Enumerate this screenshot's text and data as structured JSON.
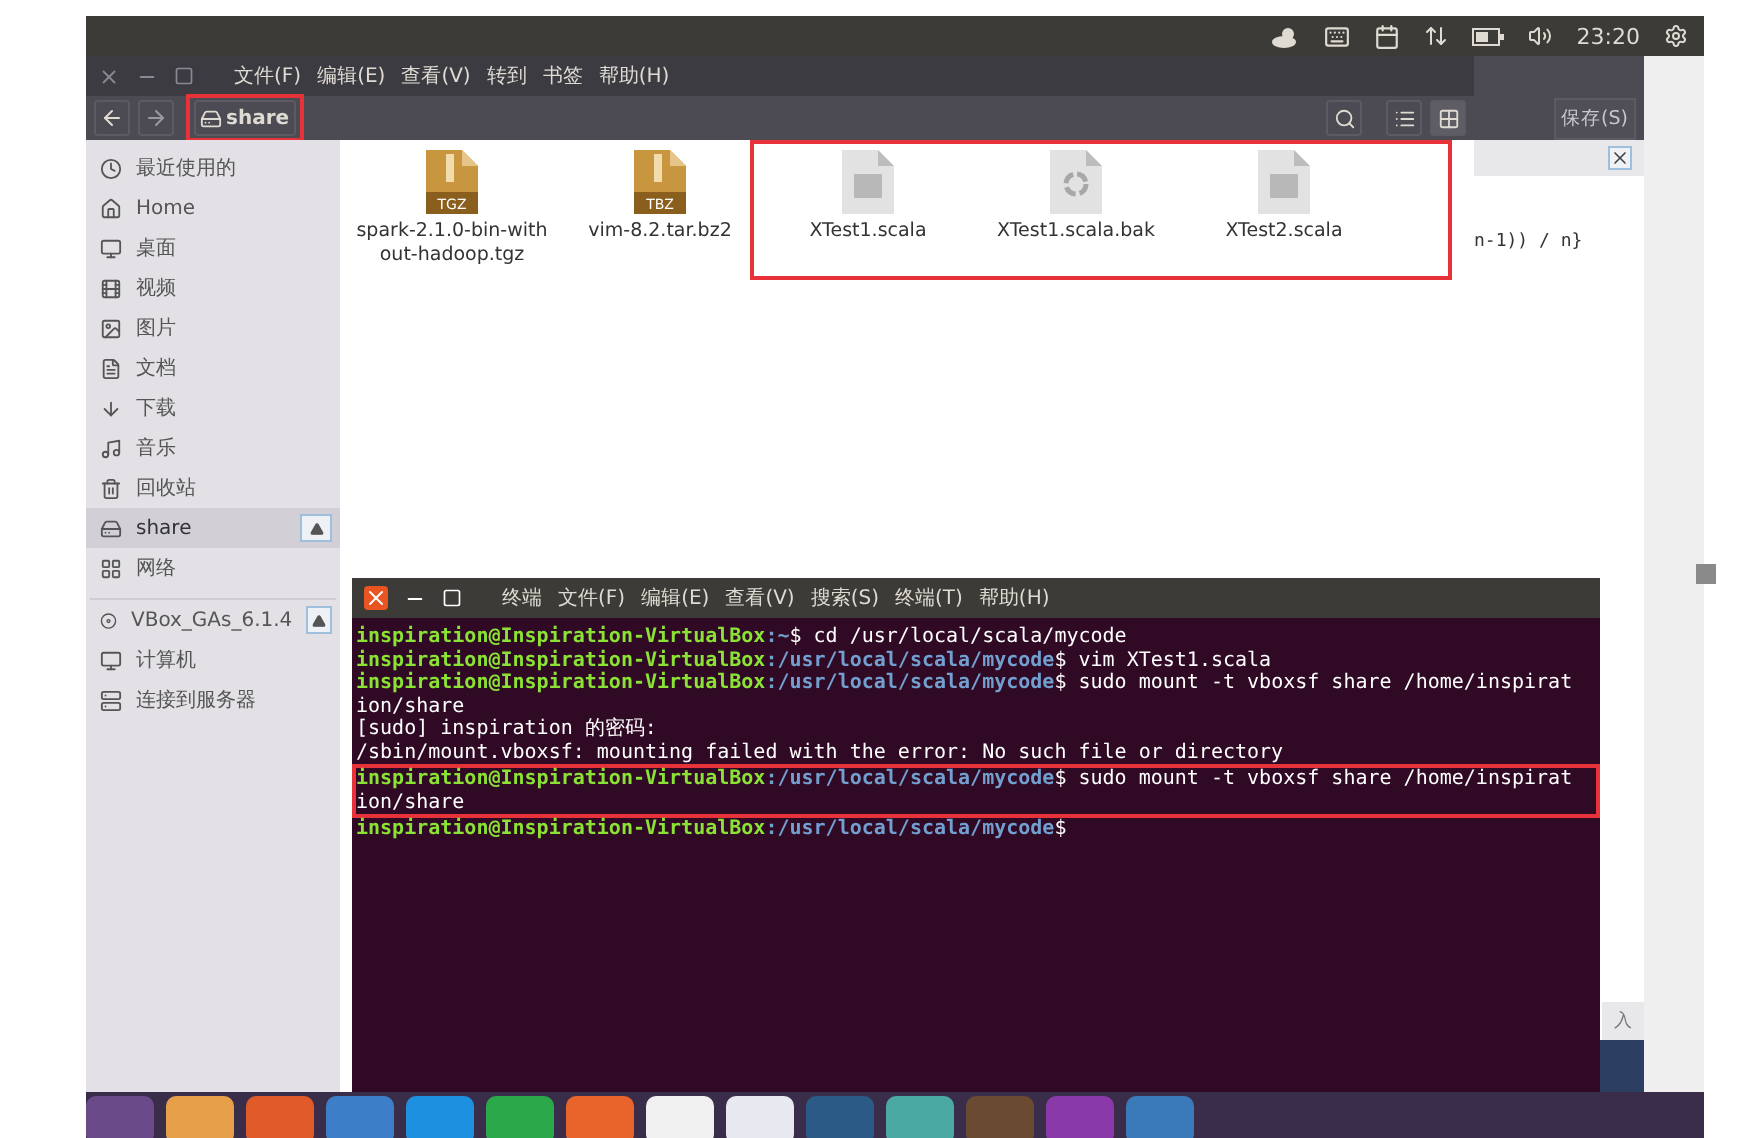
{
  "top_panel": {
    "clock": "23:20"
  },
  "file_manager": {
    "menu": [
      "文件(F)",
      "编辑(E)",
      "查看(V)",
      "转到",
      "书签",
      "帮助(H)"
    ],
    "location": {
      "label": "share",
      "highlighted": true
    },
    "views": [
      {
        "kind": "list",
        "selected": false
      },
      {
        "kind": "grid",
        "selected": true
      }
    ],
    "sidebar": [
      {
        "kind": "recent",
        "label": "最近使用的",
        "selected": false
      },
      {
        "kind": "home",
        "label": "Home",
        "selected": false
      },
      {
        "kind": "desktop",
        "label": "桌面",
        "selected": false
      },
      {
        "kind": "video",
        "label": "视频",
        "selected": false
      },
      {
        "kind": "pictures",
        "label": "图片",
        "selected": false
      },
      {
        "kind": "documents",
        "label": "文档",
        "selected": false
      },
      {
        "kind": "download",
        "label": "下载",
        "selected": false
      },
      {
        "kind": "music",
        "label": "音乐",
        "selected": false
      },
      {
        "kind": "trash",
        "label": "回收站",
        "selected": false
      },
      {
        "kind": "drive",
        "label": "share",
        "selected": true,
        "ejectable": true
      },
      {
        "kind": "network",
        "label": "网络",
        "selected": false
      },
      {
        "kind": "disc",
        "label": "VBox_GAs_6.1.4",
        "selected": false,
        "ejectable": true,
        "separated": true
      },
      {
        "kind": "computer",
        "label": "计算机",
        "selected": false
      },
      {
        "kind": "server",
        "label": "连接到服务器",
        "selected": false
      }
    ],
    "files": [
      {
        "kind": "archive",
        "badge": "TGZ",
        "name": "spark-2.1.0-bin-without-hadoop.tgz",
        "highlighted": false
      },
      {
        "kind": "archive",
        "badge": "TBZ",
        "name": "vim-8.2.tar.bz2",
        "highlighted": false
      },
      {
        "kind": "text",
        "name": "XTest1.scala",
        "highlighted": true
      },
      {
        "kind": "backup",
        "name": "XTest1.scala.bak",
        "highlighted": true
      },
      {
        "kind": "text",
        "name": "XTest2.scala",
        "highlighted": true
      }
    ]
  },
  "editor": {
    "save_button": "保存(S)",
    "code_fragment": "n-1)) / n}",
    "bottom_button": "入"
  },
  "terminal": {
    "menu": [
      "终端",
      "文件(F)",
      "编辑(E)",
      "查看(V)",
      "搜索(S)",
      "终端(T)",
      "帮助(H)"
    ],
    "lines": [
      {
        "kind": "prompt",
        "host": "inspiration@Inspiration-VirtualBox",
        "path": ":~",
        "command": "$ cd /usr/local/scala/mycode",
        "highlighted": false
      },
      {
        "kind": "prompt",
        "host": "inspiration@Inspiration-VirtualBox",
        "path": ":/usr/local/scala/mycode",
        "command": "$ vim XTest1.scala",
        "highlighted": false
      },
      {
        "kind": "prompt",
        "host": "inspiration@Inspiration-VirtualBox",
        "path": ":/usr/local/scala/mycode",
        "command": "$ sudo mount -t vboxsf share /home/inspirat",
        "continuation": "ion/share",
        "highlighted": false
      },
      {
        "kind": "output",
        "text": "[sudo] inspiration 的密码:"
      },
      {
        "kind": "output",
        "text": "/sbin/mount.vboxsf: mounting failed with the error: No such file or directory"
      },
      {
        "kind": "prompt",
        "host": "inspiration@Inspiration-VirtualBox",
        "path": ":/usr/local/scala/mycode",
        "command": "$ sudo mount -t vboxsf share /home/inspirat",
        "continuation": "ion/share",
        "highlighted": true
      },
      {
        "kind": "prompt",
        "host": "inspiration@Inspiration-VirtualBox",
        "path": ":/usr/local/scala/mycode",
        "command": "$",
        "highlighted": false
      }
    ]
  }
}
